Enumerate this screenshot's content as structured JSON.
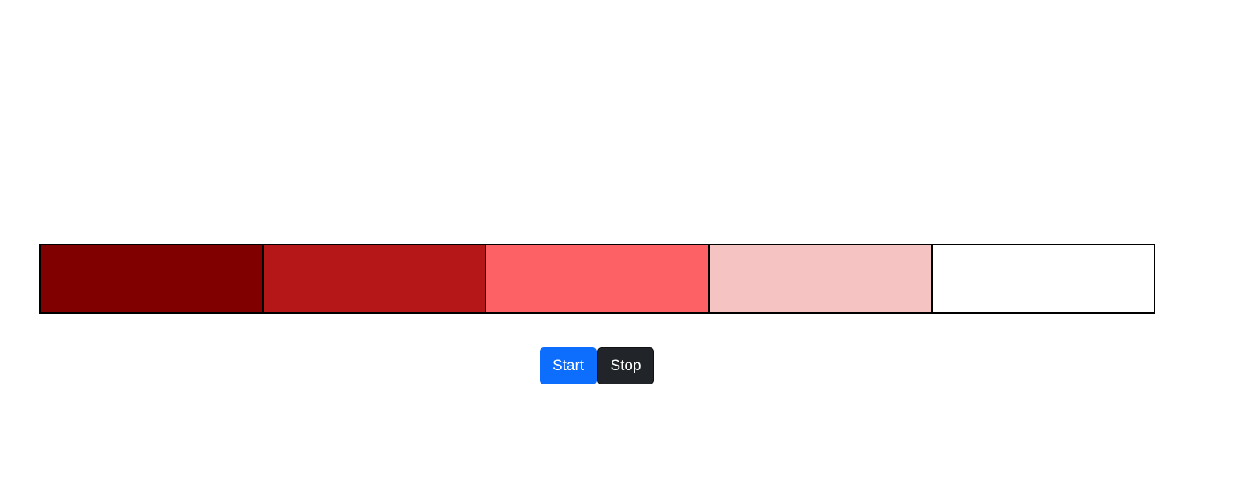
{
  "color_strip": {
    "swatches": [
      {
        "name": "swatch-1",
        "color": "#800000"
      },
      {
        "name": "swatch-2",
        "color": "#b51617"
      },
      {
        "name": "swatch-3",
        "color": "#fe6165"
      },
      {
        "name": "swatch-4",
        "color": "#f6c3c3"
      },
      {
        "name": "swatch-5",
        "color": "#ffffff"
      }
    ],
    "border_color": "#000000"
  },
  "controls": {
    "start_label": "Start",
    "start_color": "#0d6efd",
    "stop_label": "Stop",
    "stop_color": "#212529"
  }
}
